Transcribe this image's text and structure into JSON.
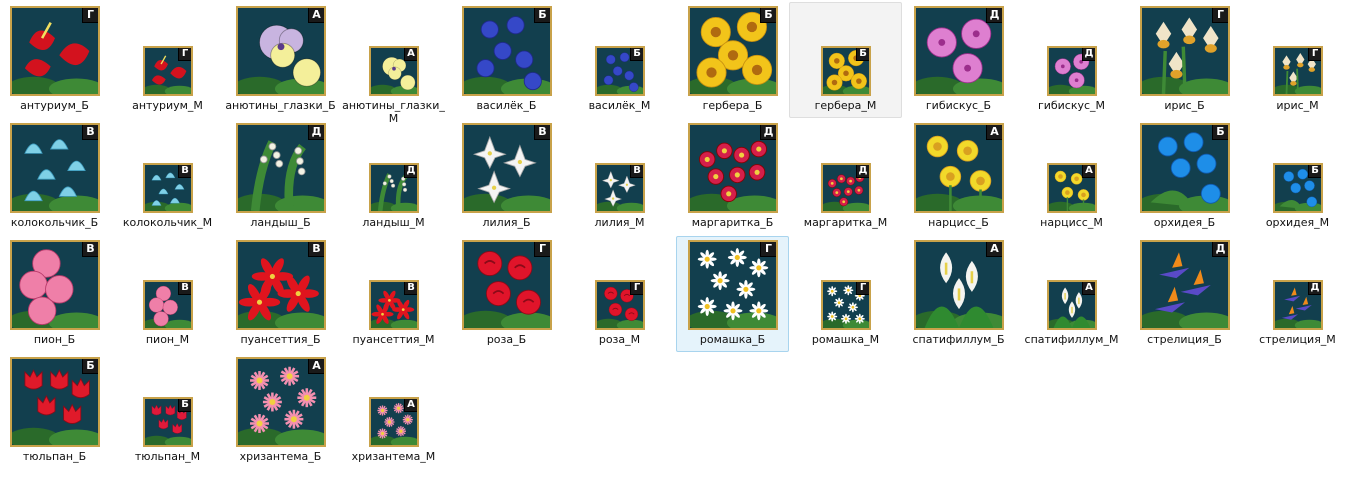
{
  "files": [
    {
      "name": "антуриум_Б",
      "letter": "Г",
      "size": "big",
      "flower": "antorium",
      "colors": [
        "#d3121e",
        "#2c7a2e"
      ]
    },
    {
      "name": "антуриум_М",
      "letter": "Г",
      "size": "small",
      "flower": "antorium",
      "colors": [
        "#d3121e",
        "#2c7a2e"
      ]
    },
    {
      "name": "анютины_глазки_Б",
      "letter": "А",
      "size": "big",
      "flower": "pansy",
      "colors": [
        "#c8b4e0",
        "#f4ef9a"
      ]
    },
    {
      "name": "анютины_глазки_М",
      "letter": "А",
      "size": "small",
      "flower": "pansy",
      "colors": [
        "#f4ef9a",
        "#d9c45a"
      ]
    },
    {
      "name": "василёк_Б",
      "letter": "Б",
      "size": "big",
      "flower": "cornflower",
      "colors": [
        "#3548c8",
        "#1f2a8a"
      ]
    },
    {
      "name": "василёк_М",
      "letter": "Б",
      "size": "small",
      "flower": "cornflower",
      "colors": [
        "#3548c8",
        "#1f2a8a"
      ]
    },
    {
      "name": "гербера_Б",
      "letter": "Б",
      "size": "big",
      "flower": "gerbera",
      "colors": [
        "#f2c41a",
        "#b06a10"
      ]
    },
    {
      "name": "гербера_М",
      "letter": "Б",
      "size": "small",
      "flower": "gerbera",
      "colors": [
        "#f2c41a",
        "#b06a10"
      ]
    },
    {
      "name": "гибискус_Б",
      "letter": "Д",
      "size": "big",
      "flower": "hibiscus",
      "colors": [
        "#de7fd0",
        "#9c2e8c"
      ]
    },
    {
      "name": "гибискус_М",
      "letter": "Д",
      "size": "small",
      "flower": "hibiscus",
      "colors": [
        "#de7fd0",
        "#9c2e8c"
      ]
    },
    {
      "name": "ирис_Б",
      "letter": "Г",
      "size": "big",
      "flower": "iris",
      "colors": [
        "#f0e4c8",
        "#e0a22a"
      ]
    },
    {
      "name": "ирис_М",
      "letter": "Г",
      "size": "small",
      "flower": "iris",
      "colors": [
        "#f0e4c8",
        "#e0a22a"
      ]
    },
    {
      "name": "колокольчик_Б",
      "letter": "В",
      "size": "big",
      "flower": "bellflower",
      "colors": [
        "#7fd0e6",
        "#3f9ec0"
      ]
    },
    {
      "name": "колокольчик_М",
      "letter": "В",
      "size": "small",
      "flower": "bellflower",
      "colors": [
        "#7fd0e6",
        "#3f9ec0"
      ]
    },
    {
      "name": "ландыш_Б",
      "letter": "Д",
      "size": "big",
      "flower": "lily-of-valley",
      "colors": [
        "#f2f2e4",
        "#3f8a30"
      ]
    },
    {
      "name": "ландыш_М",
      "letter": "Д",
      "size": "small",
      "flower": "lily-of-valley",
      "colors": [
        "#f2f2e4",
        "#3f8a30"
      ]
    },
    {
      "name": "лилия_Б",
      "letter": "В",
      "size": "big",
      "flower": "lily",
      "colors": [
        "#f4f4f4",
        "#e6d04a"
      ]
    },
    {
      "name": "лилия_М",
      "letter": "В",
      "size": "small",
      "flower": "lily",
      "colors": [
        "#f4f4f4",
        "#e6d04a"
      ]
    },
    {
      "name": "маргаритка_Б",
      "letter": "Д",
      "size": "big",
      "flower": "daisy-red",
      "colors": [
        "#d41f4a",
        "#f0d040"
      ]
    },
    {
      "name": "маргаритка_М",
      "letter": "Д",
      "size": "small",
      "flower": "daisy-red",
      "colors": [
        "#d41f4a",
        "#f0d040"
      ]
    },
    {
      "name": "нарцисс_Б",
      "letter": "А",
      "size": "big",
      "flower": "narcissus",
      "colors": [
        "#f2d92a",
        "#d9a020"
      ]
    },
    {
      "name": "нарцисс_М",
      "letter": "А",
      "size": "small",
      "flower": "narcissus",
      "colors": [
        "#f2d92a",
        "#d9a020"
      ]
    },
    {
      "name": "орхидея_Б",
      "letter": "Б",
      "size": "big",
      "flower": "orchid",
      "colors": [
        "#1e8ee8",
        "#0f5ab0"
      ]
    },
    {
      "name": "орхидея_М",
      "letter": "Б",
      "size": "small",
      "flower": "orchid",
      "colors": [
        "#1e8ee8",
        "#0f5ab0"
      ]
    },
    {
      "name": "пион_Б",
      "letter": "В",
      "size": "big",
      "flower": "peony",
      "colors": [
        "#ef7fa8",
        "#b83a6a"
      ]
    },
    {
      "name": "пион_М",
      "letter": "В",
      "size": "small",
      "flower": "peony",
      "colors": [
        "#ef7fa8",
        "#b83a6a"
      ]
    },
    {
      "name": "пуансеттия_Б",
      "letter": "В",
      "size": "big",
      "flower": "poinsettia",
      "colors": [
        "#e0141e",
        "#8a0a10"
      ]
    },
    {
      "name": "пуансеттия_М",
      "letter": "В",
      "size": "small",
      "flower": "poinsettia",
      "colors": [
        "#e0141e",
        "#8a0a10"
      ]
    },
    {
      "name": "роза_Б",
      "letter": "Г",
      "size": "big",
      "flower": "rose",
      "colors": [
        "#e0142a",
        "#8a0a18"
      ]
    },
    {
      "name": "роза_М",
      "letter": "Г",
      "size": "small",
      "flower": "rose",
      "colors": [
        "#e0142a",
        "#8a0a18"
      ]
    },
    {
      "name": "ромашка_Б",
      "letter": "Г",
      "size": "big",
      "flower": "chamomile",
      "colors": [
        "#ffffff",
        "#f0c020"
      ]
    },
    {
      "name": "ромашка_М",
      "letter": "Г",
      "size": "small",
      "flower": "chamomile",
      "colors": [
        "#ffffff",
        "#f0c020"
      ]
    },
    {
      "name": "спатифиллум_Б",
      "letter": "А",
      "size": "big",
      "flower": "spathiphyllum",
      "colors": [
        "#f4f4f0",
        "#2f8a30"
      ]
    },
    {
      "name": "спатифиллум_М",
      "letter": "А",
      "size": "small",
      "flower": "spathiphyllum",
      "colors": [
        "#f4f4f0",
        "#2f8a30"
      ]
    },
    {
      "name": "стрелиция_Б",
      "letter": "Д",
      "size": "big",
      "flower": "strelitzia",
      "colors": [
        "#f08a1a",
        "#5a4ac8"
      ]
    },
    {
      "name": "стрелиция_М",
      "letter": "Д",
      "size": "small",
      "flower": "strelitzia",
      "colors": [
        "#f08a1a",
        "#5a4ac8"
      ]
    },
    {
      "name": "тюльпан_Б",
      "letter": "Б",
      "size": "big",
      "flower": "tulip",
      "colors": [
        "#e01a2a",
        "#8a0a18"
      ]
    },
    {
      "name": "тюльпан_М",
      "letter": "Б",
      "size": "small",
      "flower": "tulip",
      "colors": [
        "#e01a3a",
        "#8a0a28"
      ]
    },
    {
      "name": "хризантема_Б",
      "letter": "А",
      "size": "big",
      "flower": "chrysanthemum",
      "colors": [
        "#f490b0",
        "#d4507a"
      ]
    },
    {
      "name": "хризантема_М",
      "letter": "А",
      "size": "small",
      "flower": "chrysanthemum",
      "colors": [
        "#f490b0",
        "#d4507a"
      ]
    }
  ],
  "selected_index": 30,
  "hover_index": 7,
  "thumb_bg": "#123f4e",
  "frame_color": "#c8a24a"
}
